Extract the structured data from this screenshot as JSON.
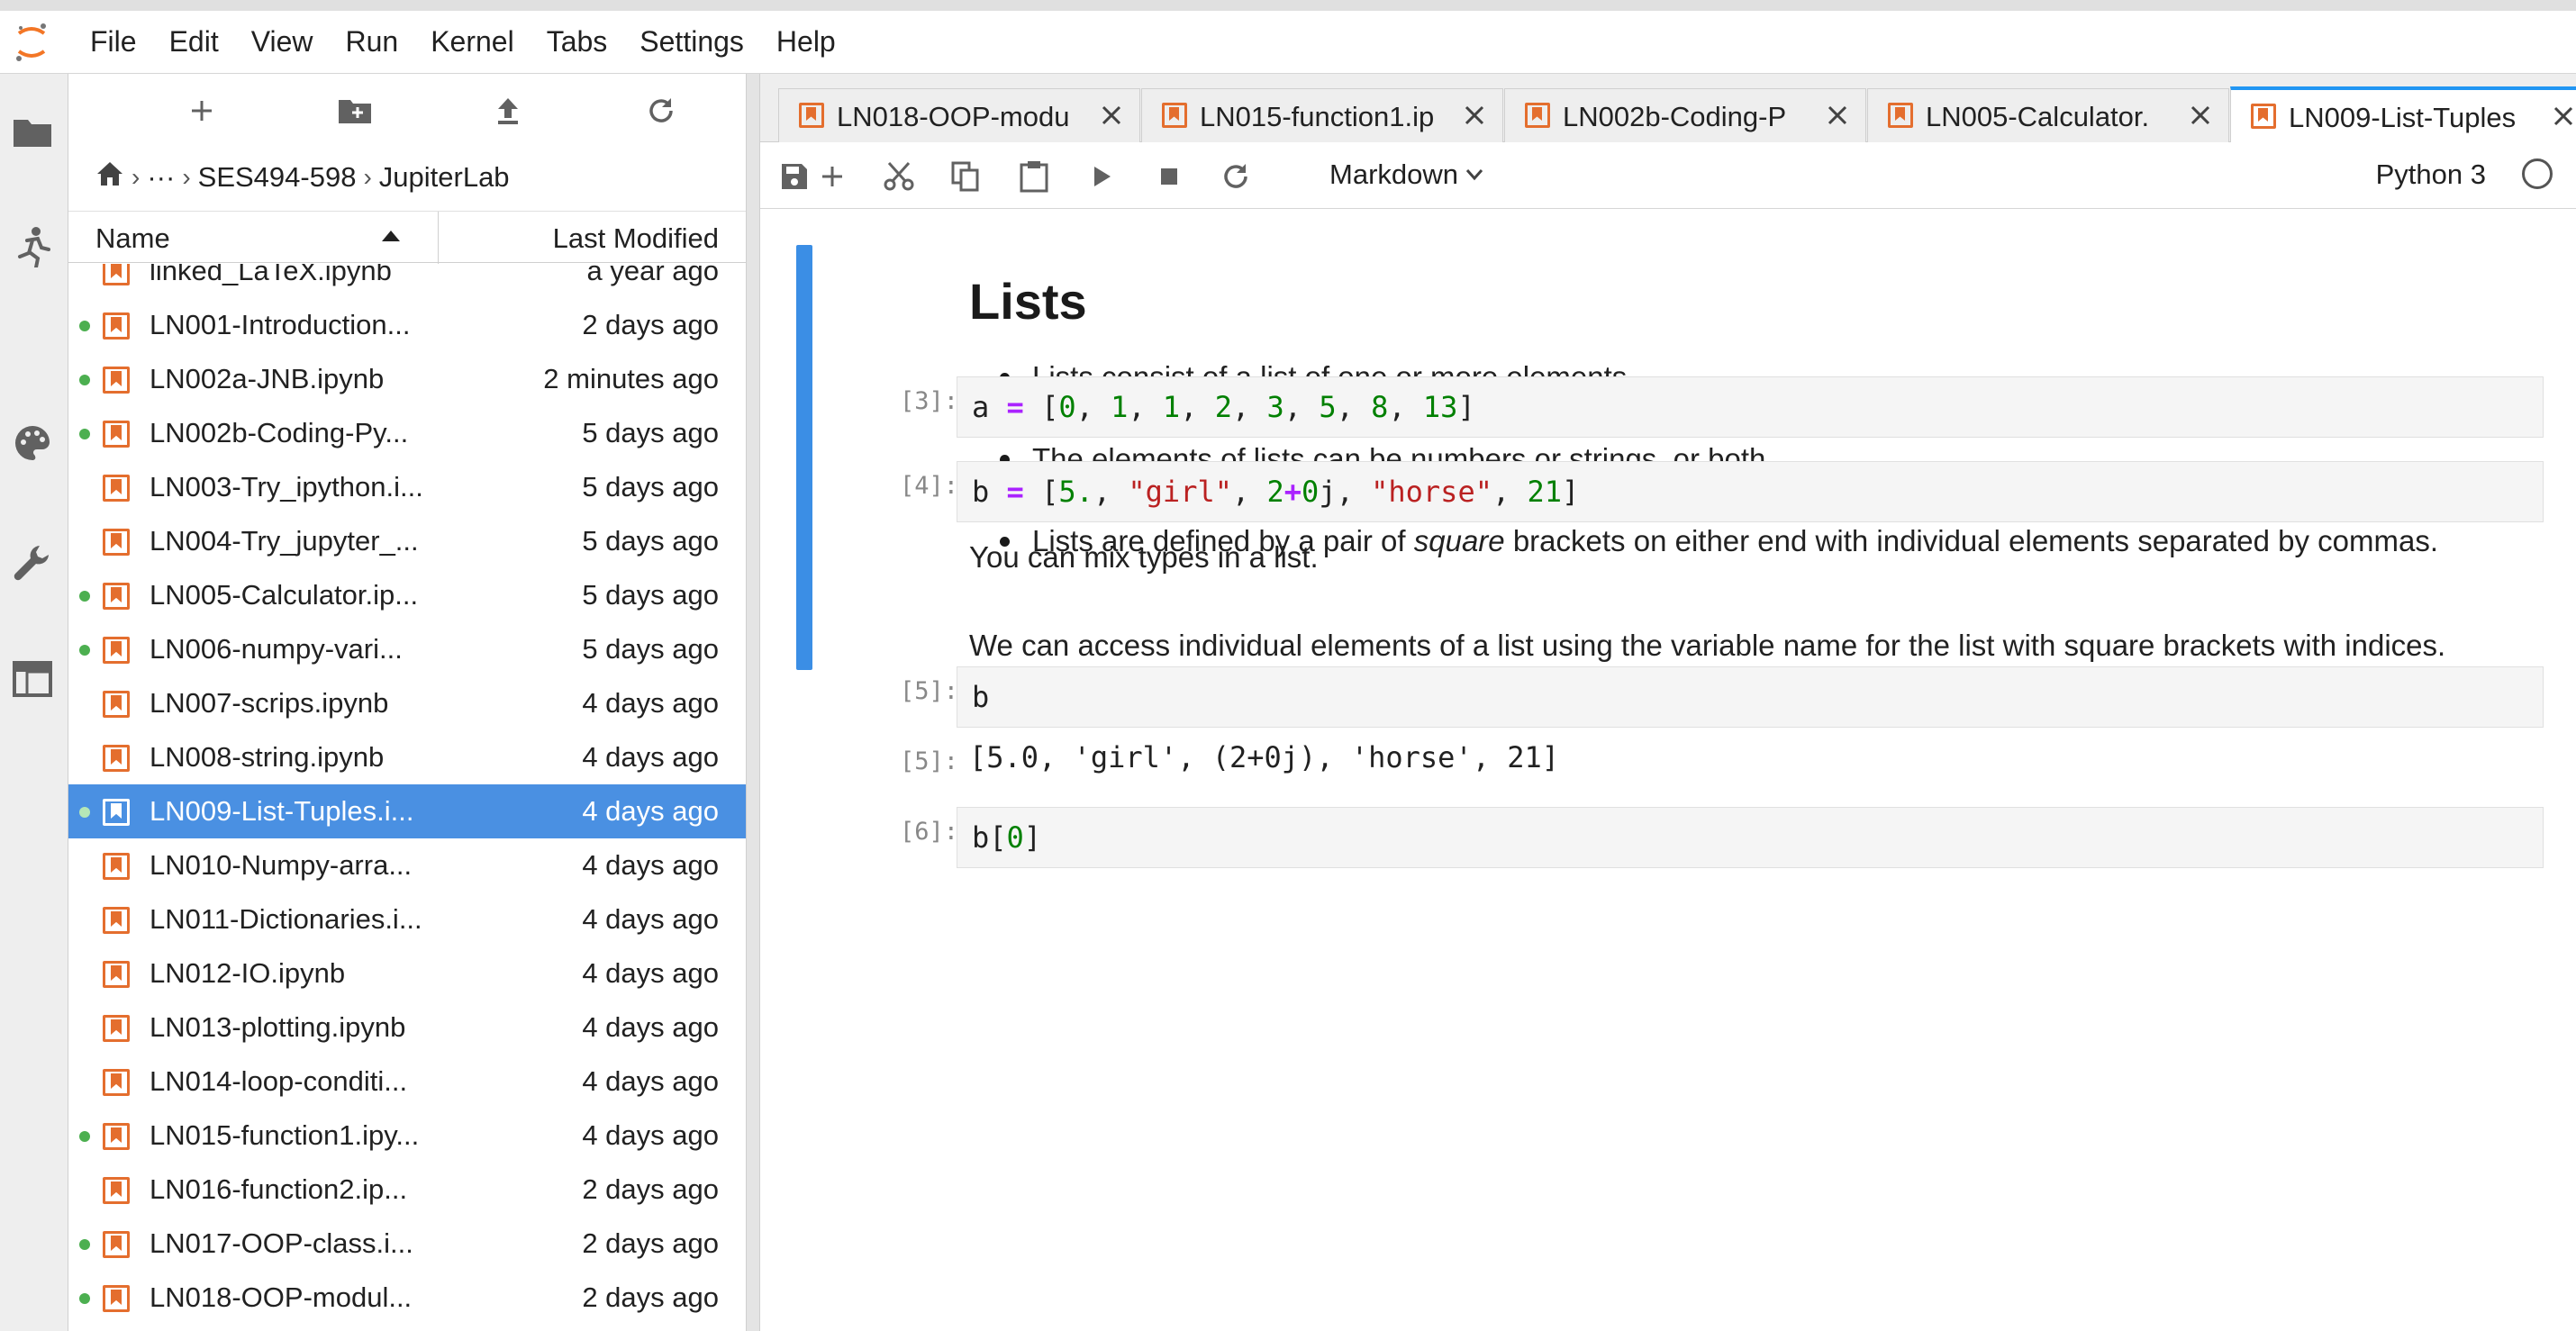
{
  "menubar": {
    "items": [
      "File",
      "Edit",
      "View",
      "Run",
      "Kernel",
      "Tabs",
      "Settings",
      "Help"
    ]
  },
  "activitybar": {
    "icons": [
      "folder-icon",
      "running-icon",
      "palette-icon",
      "wrench-icon",
      "tabs-icon"
    ]
  },
  "filebrowser": {
    "toolbar": [
      "new-launcher",
      "new-folder",
      "upload",
      "refresh"
    ],
    "breadcrumb": {
      "home": "home",
      "ellipsis": "···",
      "folder1": "SES494-598",
      "folder2": "JupiterLab"
    },
    "header": {
      "name": "Name",
      "modified": "Last Modified"
    },
    "files": [
      {
        "name": "linked_LaTeX.ipynb",
        "modified": "a year ago",
        "running": false,
        "selected": false
      },
      {
        "name": "LN001-Introduction...",
        "modified": "2 days ago",
        "running": true,
        "selected": false
      },
      {
        "name": "LN002a-JNB.ipynb",
        "modified": "2 minutes ago",
        "running": true,
        "selected": false
      },
      {
        "name": "LN002b-Coding-Py...",
        "modified": "5 days ago",
        "running": true,
        "selected": false
      },
      {
        "name": "LN003-Try_ipython.i...",
        "modified": "5 days ago",
        "running": false,
        "selected": false
      },
      {
        "name": "LN004-Try_jupyter_...",
        "modified": "5 days ago",
        "running": false,
        "selected": false
      },
      {
        "name": "LN005-Calculator.ip...",
        "modified": "5 days ago",
        "running": true,
        "selected": false
      },
      {
        "name": "LN006-numpy-vari...",
        "modified": "5 days ago",
        "running": true,
        "selected": false
      },
      {
        "name": "LN007-scrips.ipynb",
        "modified": "4 days ago",
        "running": false,
        "selected": false
      },
      {
        "name": "LN008-string.ipynb",
        "modified": "4 days ago",
        "running": false,
        "selected": false
      },
      {
        "name": "LN009-List-Tuples.i...",
        "modified": "4 days ago",
        "running": true,
        "selected": true
      },
      {
        "name": "LN010-Numpy-arra...",
        "modified": "4 days ago",
        "running": false,
        "selected": false
      },
      {
        "name": "LN011-Dictionaries.i...",
        "modified": "4 days ago",
        "running": false,
        "selected": false
      },
      {
        "name": "LN012-IO.ipynb",
        "modified": "4 days ago",
        "running": false,
        "selected": false
      },
      {
        "name": "LN013-plotting.ipynb",
        "modified": "4 days ago",
        "running": false,
        "selected": false
      },
      {
        "name": "LN014-loop-conditi...",
        "modified": "4 days ago",
        "running": false,
        "selected": false
      },
      {
        "name": "LN015-function1.ipy...",
        "modified": "4 days ago",
        "running": true,
        "selected": false
      },
      {
        "name": "LN016-function2.ip...",
        "modified": "2 days ago",
        "running": false,
        "selected": false
      },
      {
        "name": "LN017-OOP-class.i...",
        "modified": "2 days ago",
        "running": true,
        "selected": false
      },
      {
        "name": "LN018-OOP-modul...",
        "modified": "2 days ago",
        "running": true,
        "selected": false
      }
    ]
  },
  "tabs": [
    {
      "label": "LN018-OOP-modu",
      "active": false
    },
    {
      "label": "LN015-function1.ip",
      "active": false
    },
    {
      "label": "LN002b-Coding-P",
      "active": false
    },
    {
      "label": "LN005-Calculator.",
      "active": false
    },
    {
      "label": "LN009-List-Tuples",
      "active": true
    }
  ],
  "nb_toolbar": {
    "cell_type": "Markdown",
    "kernel": "Python 3"
  },
  "notebook": {
    "heading": "Lists",
    "bullets": [
      {
        "before": "Lists consist of a list of one or more elements",
        "em": "",
        "after": ""
      },
      {
        "before": "The elements of lists can be numbers or strings, or both.",
        "em": "",
        "after": ""
      },
      {
        "before": "Lists are defined by a pair of ",
        "em": "square",
        "after": " brackets on either end with individual elements separated by commas."
      }
    ],
    "cells": {
      "c3": {
        "prompt": "[3]:"
      },
      "c4": {
        "prompt": "[4]:"
      },
      "c5": {
        "prompt": "[5]:",
        "code": "b"
      },
      "o5": {
        "prompt": "[5]:",
        "text": "[5.0, 'girl', (2+0j), 'horse', 21]"
      },
      "c6": {
        "prompt": "[6]:"
      }
    },
    "p1": "You can mix types in a list.",
    "p2": "We can access individual elements of a list using the variable name for the list with square brackets with indices."
  }
}
